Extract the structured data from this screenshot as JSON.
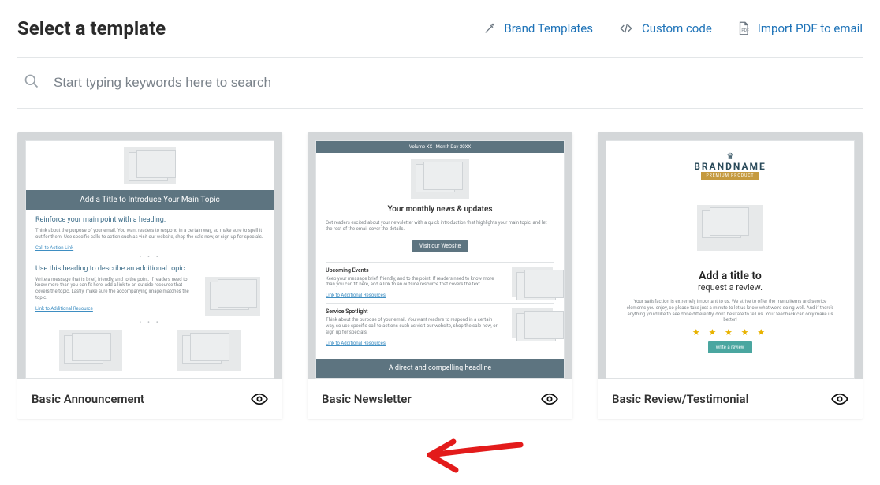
{
  "header": {
    "title": "Select a template",
    "actions": {
      "brand": "Brand Templates",
      "custom": "Custom code",
      "importpdf": "Import PDF to email"
    }
  },
  "search": {
    "placeholder": "Start typing keywords here to search"
  },
  "cards": {
    "announcement": {
      "title": "Basic Announcement",
      "p_title": "Add a Title to Introduce Your Main Topic",
      "p_h1": "Reinforce your main point with a heading.",
      "p_body1": "Think about the purpose of your email. You want readers to respond in a certain way, so make sure to spell it out for them. Use specific calls-to-action such as visit our website, shop the sale now, or sign up for specials.",
      "p_link1": "Call to Action Link",
      "p_h2": "Use this heading to describe an additional topic",
      "p_body2": "Write a message that is brief, friendly, and to the point. If readers need to know more than you can fit here, add a link to an outside resource that covers the topic. Lastly, make sure the accompanying image matches the topic.",
      "p_link2": "Link to Additional Resource"
    },
    "newsletter": {
      "title": "Basic Newsletter",
      "p_vol": "Volume XX | Month Day 20XX",
      "p_h1": "Your monthly news & updates",
      "p_intro": "Get readers excited about your newsletter with a quick introduction that highlights your main topic, and let the rest of the email cover the details.",
      "p_btn": "Visit our Website",
      "p_s1": "Upcoming Events",
      "p_s1b": "Keep your message brief, friendly, and to the point. If readers need to know more than you can fit here, add a link to an outside resource that covers the text.",
      "p_s1l": "Link to Additional Resources",
      "p_s2": "Service Spotlight",
      "p_s2b": "Think about the purpose of your email. You want readers to respond in a certain way, so use specific call-to-actions such as visit our website, shop the sale now, or sign up for specials.",
      "p_s2l": "Link to Additional Resources",
      "p_footer": "A direct and compelling headline"
    },
    "review": {
      "title": "Basic Review/Testimonial",
      "p_brand": "BRANDNAME",
      "p_chip": "PREMIUM PRODUCT",
      "p_h1": "Add a title to",
      "p_h2": "request a review.",
      "p_body": "Your satisfaction is extremely important to us. We strive to offer the menu items and service elements you enjoy, so please take just a minute to let us know what we're doing well. And if there's anything you'd like to see done differently, don't hesitate to tell us. Your feedback can only make us better!",
      "p_btn": "write a review"
    }
  }
}
